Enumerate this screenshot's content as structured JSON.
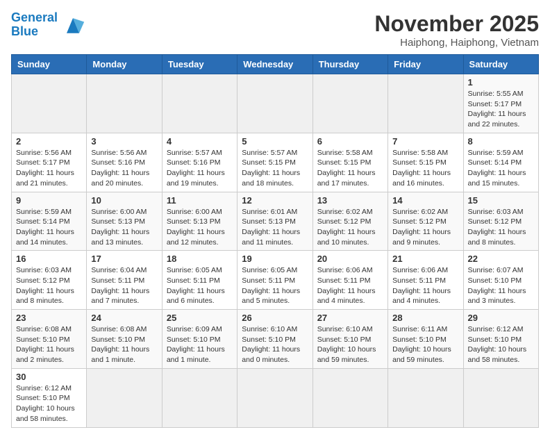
{
  "header": {
    "logo_line1": "General",
    "logo_line2": "Blue",
    "title": "November 2025",
    "subtitle": "Haiphong, Haiphong, Vietnam"
  },
  "weekdays": [
    "Sunday",
    "Monday",
    "Tuesday",
    "Wednesday",
    "Thursday",
    "Friday",
    "Saturday"
  ],
  "weeks": [
    [
      {
        "day": "",
        "info": ""
      },
      {
        "day": "",
        "info": ""
      },
      {
        "day": "",
        "info": ""
      },
      {
        "day": "",
        "info": ""
      },
      {
        "day": "",
        "info": ""
      },
      {
        "day": "",
        "info": ""
      },
      {
        "day": "1",
        "info": "Sunrise: 5:55 AM\nSunset: 5:17 PM\nDaylight: 11 hours and 22 minutes."
      }
    ],
    [
      {
        "day": "2",
        "info": "Sunrise: 5:56 AM\nSunset: 5:17 PM\nDaylight: 11 hours and 21 minutes."
      },
      {
        "day": "3",
        "info": "Sunrise: 5:56 AM\nSunset: 5:16 PM\nDaylight: 11 hours and 20 minutes."
      },
      {
        "day": "4",
        "info": "Sunrise: 5:57 AM\nSunset: 5:16 PM\nDaylight: 11 hours and 19 minutes."
      },
      {
        "day": "5",
        "info": "Sunrise: 5:57 AM\nSunset: 5:15 PM\nDaylight: 11 hours and 18 minutes."
      },
      {
        "day": "6",
        "info": "Sunrise: 5:58 AM\nSunset: 5:15 PM\nDaylight: 11 hours and 17 minutes."
      },
      {
        "day": "7",
        "info": "Sunrise: 5:58 AM\nSunset: 5:15 PM\nDaylight: 11 hours and 16 minutes."
      },
      {
        "day": "8",
        "info": "Sunrise: 5:59 AM\nSunset: 5:14 PM\nDaylight: 11 hours and 15 minutes."
      }
    ],
    [
      {
        "day": "9",
        "info": "Sunrise: 5:59 AM\nSunset: 5:14 PM\nDaylight: 11 hours and 14 minutes."
      },
      {
        "day": "10",
        "info": "Sunrise: 6:00 AM\nSunset: 5:13 PM\nDaylight: 11 hours and 13 minutes."
      },
      {
        "day": "11",
        "info": "Sunrise: 6:00 AM\nSunset: 5:13 PM\nDaylight: 11 hours and 12 minutes."
      },
      {
        "day": "12",
        "info": "Sunrise: 6:01 AM\nSunset: 5:13 PM\nDaylight: 11 hours and 11 minutes."
      },
      {
        "day": "13",
        "info": "Sunrise: 6:02 AM\nSunset: 5:12 PM\nDaylight: 11 hours and 10 minutes."
      },
      {
        "day": "14",
        "info": "Sunrise: 6:02 AM\nSunset: 5:12 PM\nDaylight: 11 hours and 9 minutes."
      },
      {
        "day": "15",
        "info": "Sunrise: 6:03 AM\nSunset: 5:12 PM\nDaylight: 11 hours and 8 minutes."
      }
    ],
    [
      {
        "day": "16",
        "info": "Sunrise: 6:03 AM\nSunset: 5:12 PM\nDaylight: 11 hours and 8 minutes."
      },
      {
        "day": "17",
        "info": "Sunrise: 6:04 AM\nSunset: 5:11 PM\nDaylight: 11 hours and 7 minutes."
      },
      {
        "day": "18",
        "info": "Sunrise: 6:05 AM\nSunset: 5:11 PM\nDaylight: 11 hours and 6 minutes."
      },
      {
        "day": "19",
        "info": "Sunrise: 6:05 AM\nSunset: 5:11 PM\nDaylight: 11 hours and 5 minutes."
      },
      {
        "day": "20",
        "info": "Sunrise: 6:06 AM\nSunset: 5:11 PM\nDaylight: 11 hours and 4 minutes."
      },
      {
        "day": "21",
        "info": "Sunrise: 6:06 AM\nSunset: 5:11 PM\nDaylight: 11 hours and 4 minutes."
      },
      {
        "day": "22",
        "info": "Sunrise: 6:07 AM\nSunset: 5:10 PM\nDaylight: 11 hours and 3 minutes."
      }
    ],
    [
      {
        "day": "23",
        "info": "Sunrise: 6:08 AM\nSunset: 5:10 PM\nDaylight: 11 hours and 2 minutes."
      },
      {
        "day": "24",
        "info": "Sunrise: 6:08 AM\nSunset: 5:10 PM\nDaylight: 11 hours and 1 minute."
      },
      {
        "day": "25",
        "info": "Sunrise: 6:09 AM\nSunset: 5:10 PM\nDaylight: 11 hours and 1 minute."
      },
      {
        "day": "26",
        "info": "Sunrise: 6:10 AM\nSunset: 5:10 PM\nDaylight: 11 hours and 0 minutes."
      },
      {
        "day": "27",
        "info": "Sunrise: 6:10 AM\nSunset: 5:10 PM\nDaylight: 10 hours and 59 minutes."
      },
      {
        "day": "28",
        "info": "Sunrise: 6:11 AM\nSunset: 5:10 PM\nDaylight: 10 hours and 59 minutes."
      },
      {
        "day": "29",
        "info": "Sunrise: 6:12 AM\nSunset: 5:10 PM\nDaylight: 10 hours and 58 minutes."
      }
    ],
    [
      {
        "day": "30",
        "info": "Sunrise: 6:12 AM\nSunset: 5:10 PM\nDaylight: 10 hours and 58 minutes."
      },
      {
        "day": "",
        "info": ""
      },
      {
        "day": "",
        "info": ""
      },
      {
        "day": "",
        "info": ""
      },
      {
        "day": "",
        "info": ""
      },
      {
        "day": "",
        "info": ""
      },
      {
        "day": "",
        "info": ""
      }
    ]
  ]
}
